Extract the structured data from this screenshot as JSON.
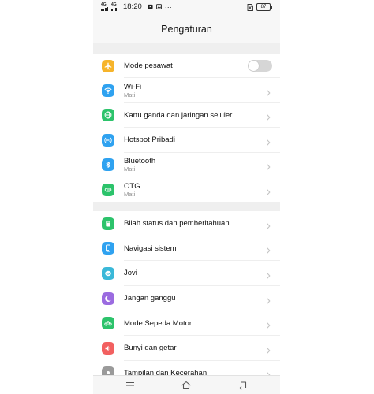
{
  "status_bar": {
    "sim1_label": "4G",
    "sim2_label": "4G",
    "time": "18:20",
    "more": "···",
    "battery": "87"
  },
  "header": {
    "title": "Pengaturan"
  },
  "colors": {
    "airplane": "#f6b42b",
    "wifi": "#2fa2f0",
    "dual_sim": "#2cc36b",
    "hotspot": "#2fa2f0",
    "bluetooth": "#2fa2f0",
    "otg": "#2cc36b",
    "statusbar": "#2cc36b",
    "navigation": "#2fa2f0",
    "jovi": "#3ab8d8",
    "dnd": "#9b6be0",
    "motorbike": "#2cc36b",
    "sound": "#f26060",
    "display": "#9a9a9a"
  },
  "groups": [
    {
      "items": [
        {
          "label": "Mode pesawat",
          "icon": "airplane-icon",
          "toggle": false
        },
        {
          "label": "Wi-Fi",
          "sub": "Mati",
          "icon": "wifi-icon"
        },
        {
          "label": "Kartu ganda dan jaringan seluler",
          "icon": "globe-icon"
        },
        {
          "label": "Hotspot Pribadi",
          "icon": "hotspot-icon"
        },
        {
          "label": "Bluetooth",
          "sub": "Mati",
          "icon": "bluetooth-icon"
        },
        {
          "label": "OTG",
          "sub": "Mati",
          "icon": "otg-icon"
        }
      ]
    },
    {
      "items": [
        {
          "label": "Bilah status dan pemberitahuan",
          "icon": "notification-icon"
        },
        {
          "label": "Navigasi sistem",
          "icon": "navigation-icon"
        },
        {
          "label": "Jovi",
          "icon": "jovi-icon"
        },
        {
          "label": "Jangan ganggu",
          "icon": "moon-icon"
        },
        {
          "label": "Mode Sepeda Motor",
          "icon": "motorbike-icon"
        },
        {
          "label": "Bunyi dan getar",
          "icon": "speaker-icon"
        },
        {
          "label": "Tampilan dan Kecerahan",
          "icon": "display-icon"
        }
      ]
    }
  ],
  "nav_bar": {
    "menu": "menu-icon",
    "home": "home-icon",
    "back": "back-icon"
  }
}
